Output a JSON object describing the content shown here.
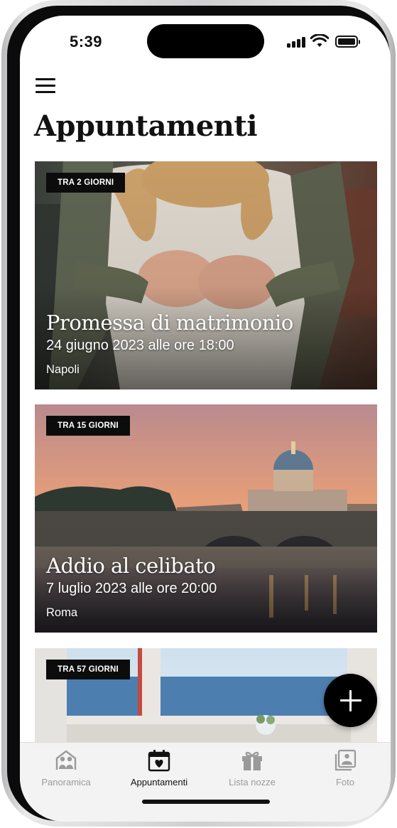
{
  "status_bar": {
    "time": "5:39"
  },
  "header": {
    "title": "Appuntamenti",
    "menu_icon": "hamburger-menu-icon"
  },
  "events": [
    {
      "badge": "TRA 2 GIORNI",
      "title": "Promessa di matrimonio",
      "date": "24 giugno 2023 alle ore 18:00",
      "place": "Napoli"
    },
    {
      "badge": "TRA 15 GIORNI",
      "title": "Addio al celibato",
      "date": "7 luglio 2023 alle ore 20:00",
      "place": "Roma"
    },
    {
      "badge": "TRA 57 GIORNI"
    }
  ],
  "fab": {
    "icon": "plus-icon"
  },
  "tabbar": {
    "items": [
      {
        "label": "Panoramica",
        "icon": "couple-icon",
        "active": false
      },
      {
        "label": "Appuntamenti",
        "icon": "calendar-heart-icon",
        "active": true
      },
      {
        "label": "Lista nozze",
        "icon": "gift-icon",
        "active": false
      },
      {
        "label": "Foto",
        "icon": "photo-icon",
        "active": false
      }
    ]
  },
  "colors": {
    "accent": "#111111",
    "inactive": "#9a9a9a",
    "background": "#ffffff"
  }
}
